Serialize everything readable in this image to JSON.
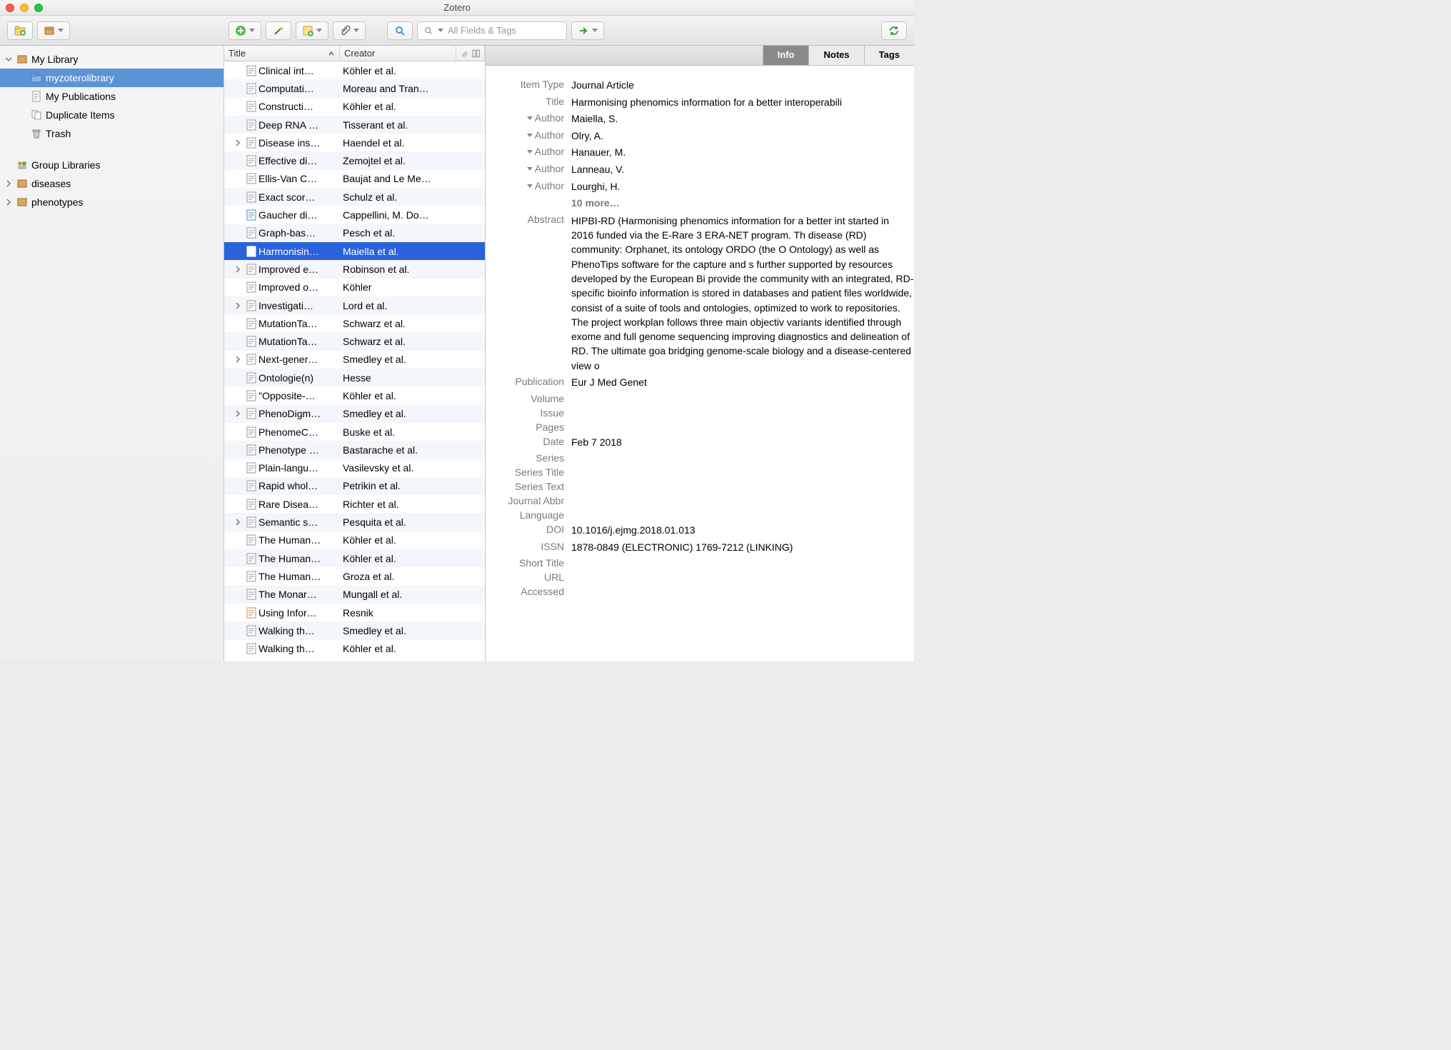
{
  "window": {
    "title": "Zotero"
  },
  "search": {
    "placeholder": "All Fields & Tags"
  },
  "sidebar": {
    "mylib": "My Library",
    "sub": [
      {
        "label": "myzoterolibrary",
        "icon": "folder",
        "selected": true
      },
      {
        "label": "My Publications",
        "icon": "doc"
      },
      {
        "label": "Duplicate Items",
        "icon": "dup"
      },
      {
        "label": "Trash",
        "icon": "trash"
      }
    ],
    "group": "Group Libraries",
    "groups": [
      {
        "label": "diseases"
      },
      {
        "label": "phenotypes"
      }
    ]
  },
  "columns": {
    "title": "Title",
    "creator": "Creator"
  },
  "items": [
    {
      "title": "Clinical int…",
      "creator": "Köhler et al."
    },
    {
      "title": "Computati…",
      "creator": "Moreau and Tran…"
    },
    {
      "title": "Constructi…",
      "creator": "Köhler et al."
    },
    {
      "title": "Deep RNA …",
      "creator": "Tisserant et al."
    },
    {
      "title": "Disease ins…",
      "creator": "Haendel et al.",
      "exp": true
    },
    {
      "title": "Effective di…",
      "creator": "Zemojtel et al."
    },
    {
      "title": "Ellis-Van C…",
      "creator": "Baujat and Le Me…"
    },
    {
      "title": "Exact scor…",
      "creator": "Schulz et al."
    },
    {
      "title": "Gaucher di…",
      "creator": "Cappellini, M. Do…",
      "blue": true
    },
    {
      "title": "Graph-bas…",
      "creator": "Pesch et al."
    },
    {
      "title": "Harmonisin…",
      "creator": "Maiella et al.",
      "selected": true
    },
    {
      "title": "Improved e…",
      "creator": "Robinson et al.",
      "exp": true
    },
    {
      "title": "Improved o…",
      "creator": "Köhler"
    },
    {
      "title": "Investigati…",
      "creator": "Lord et al.",
      "exp": true
    },
    {
      "title": "MutationTa…",
      "creator": "Schwarz et al."
    },
    {
      "title": "MutationTa…",
      "creator": "Schwarz et al."
    },
    {
      "title": "Next-gener…",
      "creator": "Smedley et al.",
      "exp": true
    },
    {
      "title": "Ontologie(n)",
      "creator": "Hesse"
    },
    {
      "title": "\"Opposite-…",
      "creator": "Köhler et al."
    },
    {
      "title": "PhenoDigm…",
      "creator": "Smedley et al.",
      "exp": true
    },
    {
      "title": "PhenomeC…",
      "creator": "Buske et al."
    },
    {
      "title": "Phenotype …",
      "creator": "Bastarache et al."
    },
    {
      "title": "Plain-langu…",
      "creator": "Vasilevsky et al."
    },
    {
      "title": "Rapid whol…",
      "creator": "Petrikin et al."
    },
    {
      "title": "Rare Disea…",
      "creator": "Richter et al."
    },
    {
      "title": "Semantic s…",
      "creator": "Pesquita et al.",
      "exp": true
    },
    {
      "title": "The Human…",
      "creator": "Köhler et al."
    },
    {
      "title": "The Human…",
      "creator": "Köhler et al."
    },
    {
      "title": "The Human…",
      "creator": "Groza et al."
    },
    {
      "title": "The Monar…",
      "creator": "Mungall et al."
    },
    {
      "title": "Using Infor…",
      "creator": "Resnik",
      "colored": true
    },
    {
      "title": "Walking th…",
      "creator": "Smedley et al."
    },
    {
      "title": "Walking th…",
      "creator": "Köhler et al."
    }
  ],
  "tabs": {
    "info": "Info",
    "notes": "Notes",
    "tags": "Tags"
  },
  "meta": {
    "labels": {
      "item_type": "Item Type",
      "title": "Title",
      "author": "Author",
      "abstract": "Abstract",
      "publication": "Publication",
      "volume": "Volume",
      "issue": "Issue",
      "pages": "Pages",
      "date": "Date",
      "series": "Series",
      "series_title": "Series Title",
      "series_text": "Series Text",
      "journal_abbr": "Journal Abbr",
      "language": "Language",
      "doi": "DOI",
      "issn": "ISSN",
      "short_title": "Short Title",
      "url": "URL",
      "accessed": "Accessed",
      "more": "10 more…"
    },
    "item_type": "Journal Article",
    "title": "Harmonising phenomics information for a better interoperabili",
    "authors": [
      "Maiella, S.",
      "Olry, A.",
      "Hanauer, M.",
      "Lanneau, V.",
      "Lourghi, H."
    ],
    "abstract": "HIPBI-RD (Harmonising phenomics information for a better int started in 2016 funded via the E-Rare 3 ERA-NET program. Th disease (RD) community: Orphanet, its ontology ORDO (the O Ontology) as well as PhenoTips software for the capture and s further supported by resources developed by the European Bi provide the community with an integrated, RD-specific bioinfo information is stored in databases and patient files worldwide, consist of a suite of tools and ontologies, optimized to work to repositories. The project workplan follows three main objectiv variants identified through exome and full genome sequencing improving diagnostics and delineation of RD. The ultimate goa bridging genome-scale biology and a disease-centered view o",
    "publication": "Eur J Med Genet",
    "volume": "",
    "issue": "",
    "pages": "",
    "date": "Feb 7 2018",
    "series": "",
    "series_title": "",
    "series_text": "",
    "journal_abbr": "",
    "language": "",
    "doi": "10.1016/j.ejmg.2018.01.013",
    "issn": "1878-0849 (ELECTRONIC) 1769-7212 (LINKING)",
    "short_title": "",
    "url": "",
    "accessed": ""
  }
}
